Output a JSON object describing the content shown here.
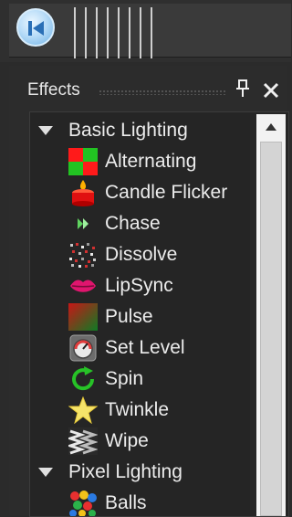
{
  "panel": {
    "title": "Effects",
    "pin_glyph": "ť",
    "close_glyph": "✕"
  },
  "groups": [
    {
      "label": "Basic Lighting",
      "items": [
        {
          "label": "Alternating",
          "icon": "alternating-icon"
        },
        {
          "label": "Candle Flicker",
          "icon": "candle-icon"
        },
        {
          "label": "Chase",
          "icon": "chase-icon"
        },
        {
          "label": "Dissolve",
          "icon": "dissolve-icon"
        },
        {
          "label": "LipSync",
          "icon": "lips-icon"
        },
        {
          "label": "Pulse",
          "icon": "pulse-icon"
        },
        {
          "label": "Set Level",
          "icon": "gauge-icon"
        },
        {
          "label": "Spin",
          "icon": "spin-icon"
        },
        {
          "label": "Twinkle",
          "icon": "star-icon"
        },
        {
          "label": "Wipe",
          "icon": "wipe-icon"
        }
      ]
    },
    {
      "label": "Pixel Lighting",
      "items": [
        {
          "label": "Balls",
          "icon": "balls-icon"
        }
      ]
    }
  ]
}
